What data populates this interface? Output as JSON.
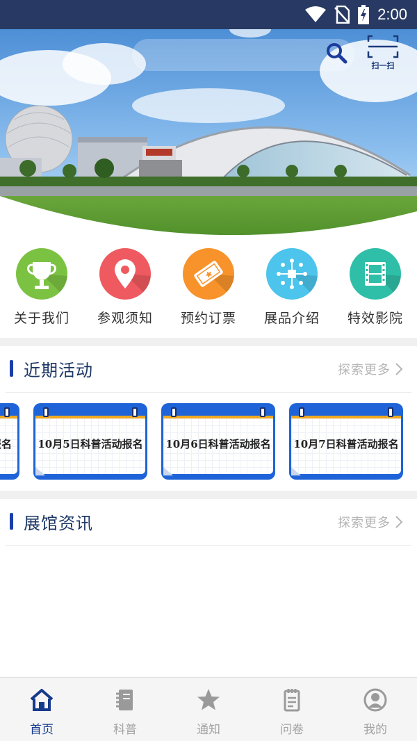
{
  "status_bar": {
    "time": "2:00"
  },
  "header": {
    "scan_label": "扫一扫"
  },
  "quick_menu": [
    {
      "label": "关于我们",
      "icon": "trophy-icon",
      "color": "#7cc242"
    },
    {
      "label": "参观须知",
      "icon": "location-pin-icon",
      "color": "#ee5a5f"
    },
    {
      "label": "预约订票",
      "icon": "ticket-icon",
      "color": "#f7932a"
    },
    {
      "label": "展品介绍",
      "icon": "exhibit-icon",
      "color": "#4cc4ec"
    },
    {
      "label": "特效影院",
      "icon": "film-icon",
      "color": "#2fbfa8"
    }
  ],
  "activities": {
    "title": "近期活动",
    "more": "探索更多",
    "cards": [
      {
        "text": "报名"
      },
      {
        "text": "10月5日科普活动报名"
      },
      {
        "text": "10月6日科普活动报名"
      },
      {
        "text": "10月7日科普活动报名"
      }
    ]
  },
  "news": {
    "title": "展馆资讯",
    "more": "探索更多"
  },
  "bottom_nav": [
    {
      "label": "首页",
      "icon": "home-icon",
      "active": true
    },
    {
      "label": "科普",
      "icon": "book-icon",
      "active": false
    },
    {
      "label": "通知",
      "icon": "star-icon",
      "active": false
    },
    {
      "label": "问卷",
      "icon": "clipboard-icon",
      "active": false
    },
    {
      "label": "我的",
      "icon": "user-icon",
      "active": false
    }
  ],
  "colors": {
    "accent": "#1a3fa8",
    "status_bar": "#283a63",
    "muted": "#b5b5b5"
  }
}
